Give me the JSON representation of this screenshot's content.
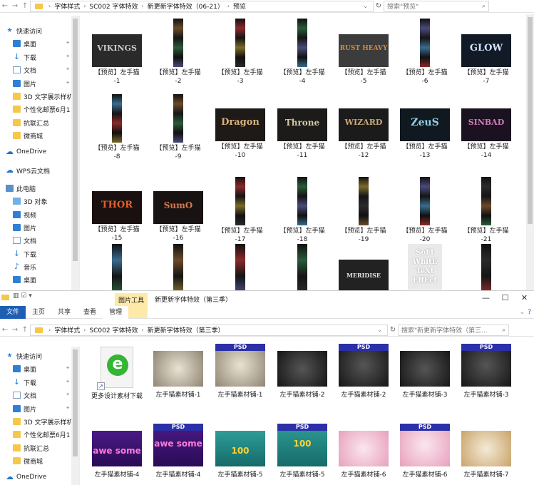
{
  "colors": {
    "accent": "#1e5fb3",
    "folder": "#f5c84a",
    "context_tab": "#fde9a8",
    "psd_banner": "#2b2fa8"
  },
  "top": {
    "crumbs": [
      "字体样式",
      "SC002 字体特效",
      "新更新字体特效（06-21）",
      "预览"
    ],
    "search_placeholder": "搜索\"预览\"",
    "nav": [
      {
        "label": "快速访问",
        "icon": "star-icon"
      },
      {
        "label": "桌面",
        "icon": "desktop-icon",
        "pin": true
      },
      {
        "label": "下载",
        "icon": "download-icon",
        "pin": true
      },
      {
        "label": "文档",
        "icon": "document-icon",
        "pin": true
      },
      {
        "label": "图片",
        "icon": "pictures-icon",
        "pin": true
      },
      {
        "label": "3D 文字展示样机",
        "icon": "folder-icon"
      },
      {
        "label": "个性化邮票6月1",
        "icon": "folder-icon"
      },
      {
        "label": "抗联汇总",
        "icon": "folder-icon"
      },
      {
        "label": "微商城",
        "icon": "folder-icon"
      },
      {
        "label": "OneDrive",
        "icon": "onedrive-icon"
      },
      {
        "label": "WPS云文档",
        "icon": "wps-cloud-icon"
      },
      {
        "label": "此电脑",
        "icon": "computer-icon"
      },
      {
        "label": "3D 对象",
        "icon": "3d-objects-icon"
      },
      {
        "label": "视频",
        "icon": "video-icon"
      },
      {
        "label": "图片",
        "icon": "pictures-icon"
      },
      {
        "label": "文档",
        "icon": "document-icon"
      },
      {
        "label": "下载",
        "icon": "download-icon"
      },
      {
        "label": "音乐",
        "icon": "music-icon"
      },
      {
        "label": "桌面",
        "icon": "desktop-icon"
      }
    ],
    "files": [
      {
        "line1": "【预览】左手猫",
        "line2": "-1",
        "art": "VIKINGS"
      },
      {
        "line1": "【预览】左手猫",
        "line2": "-2"
      },
      {
        "line1": "【预览】左手猫",
        "line2": "-3"
      },
      {
        "line1": "【预览】左手猫",
        "line2": "-4"
      },
      {
        "line1": "【预览】左手猫",
        "line2": "-5",
        "art": "RUST HEAVY"
      },
      {
        "line1": "【预览】左手猫",
        "line2": "-6"
      },
      {
        "line1": "【预览】左手猫",
        "line2": "-7",
        "art": "GLOW"
      },
      {
        "line1": "【预览】左手猫",
        "line2": "-8"
      },
      {
        "line1": "【预览】左手猫",
        "line2": "-9"
      },
      {
        "line1": "【预览】左手猫",
        "line2": "-10",
        "art": "Dragon"
      },
      {
        "line1": "【预览】左手猫",
        "line2": "-11",
        "art": "Throne"
      },
      {
        "line1": "【预览】左手猫",
        "line2": "-12",
        "art": "WIZARD"
      },
      {
        "line1": "【预览】左手猫",
        "line2": "-13",
        "art": "ZeuS"
      },
      {
        "line1": "【预览】左手猫",
        "line2": "-14",
        "art": "SINBAD"
      },
      {
        "line1": "【预览】左手猫",
        "line2": "-15",
        "art": "THOR"
      },
      {
        "line1": "【预览】左手猫",
        "line2": "-16",
        "art": "SumO"
      },
      {
        "line1": "【预览】左手猫",
        "line2": "-17"
      },
      {
        "line1": "【预览】左手猫",
        "line2": "-18"
      },
      {
        "line1": "【预览】左手猫",
        "line2": "-19"
      },
      {
        "line1": "【预览】左手猫",
        "line2": "-20"
      },
      {
        "line1": "【预览】左手猫",
        "line2": "-21"
      }
    ],
    "row4_art": {
      "meridise": "MERIDISE",
      "soft": "SoFt WhitE TeXt EffEct"
    }
  },
  "bottom": {
    "context_tab": "图片工具",
    "window_title": "新更新字体特效（第三季）",
    "tabs": [
      "文件",
      "主页",
      "共享",
      "查看",
      "管理"
    ],
    "crumbs": [
      "字体样式",
      "SC002 字体特效",
      "新更新字体特效（第三季）"
    ],
    "search_placeholder": "搜索\"新更新字体特效（第三...",
    "controls": {
      "min": "—",
      "max": "☐",
      "close": "✕"
    },
    "nav": [
      {
        "label": "快速访问",
        "icon": "star-icon"
      },
      {
        "label": "桌面",
        "icon": "desktop-icon",
        "pin": true
      },
      {
        "label": "下载",
        "icon": "download-icon",
        "pin": true
      },
      {
        "label": "文档",
        "icon": "document-icon",
        "pin": true
      },
      {
        "label": "图片",
        "icon": "pictures-icon",
        "pin": true
      },
      {
        "label": "3D 文字展示样机",
        "icon": "folder-icon"
      },
      {
        "label": "个性化邮票6月1",
        "icon": "folder-icon"
      },
      {
        "label": "抗联汇总",
        "icon": "folder-icon"
      },
      {
        "label": "微商城",
        "icon": "folder-icon"
      },
      {
        "label": "OneDrive",
        "icon": "onedrive-icon"
      }
    ],
    "psd_label": "PSD",
    "files": [
      {
        "label": "更多设计素材下载",
        "kind": "ie"
      },
      {
        "label": "左手猫素材铺-1",
        "kind": "gold"
      },
      {
        "label": "左手猫素材铺-1",
        "kind": "gold-psd"
      },
      {
        "label": "左手猫素材铺-2",
        "kind": "dark"
      },
      {
        "label": "左手猫素材铺-2",
        "kind": "dark-psd"
      },
      {
        "label": "左手猫素材铺-3",
        "kind": "dark"
      },
      {
        "label": "左手猫素材铺-3",
        "kind": "dark-psd"
      },
      {
        "label": "左手猫素材铺-4",
        "kind": "purple",
        "art": "awe some"
      },
      {
        "label": "左手猫素材铺-4",
        "kind": "purple-psd",
        "art": "awe some"
      },
      {
        "label": "左手猫素材铺-5",
        "kind": "teal",
        "art": "100"
      },
      {
        "label": "左手猫素材铺-5",
        "kind": "teal-psd",
        "art": "100"
      },
      {
        "label": "左手猫素材铺-6",
        "kind": "pink"
      },
      {
        "label": "左手猫素材铺-6",
        "kind": "pink-psd"
      },
      {
        "label": "左手猫素材铺-7",
        "kind": "cream"
      }
    ]
  }
}
